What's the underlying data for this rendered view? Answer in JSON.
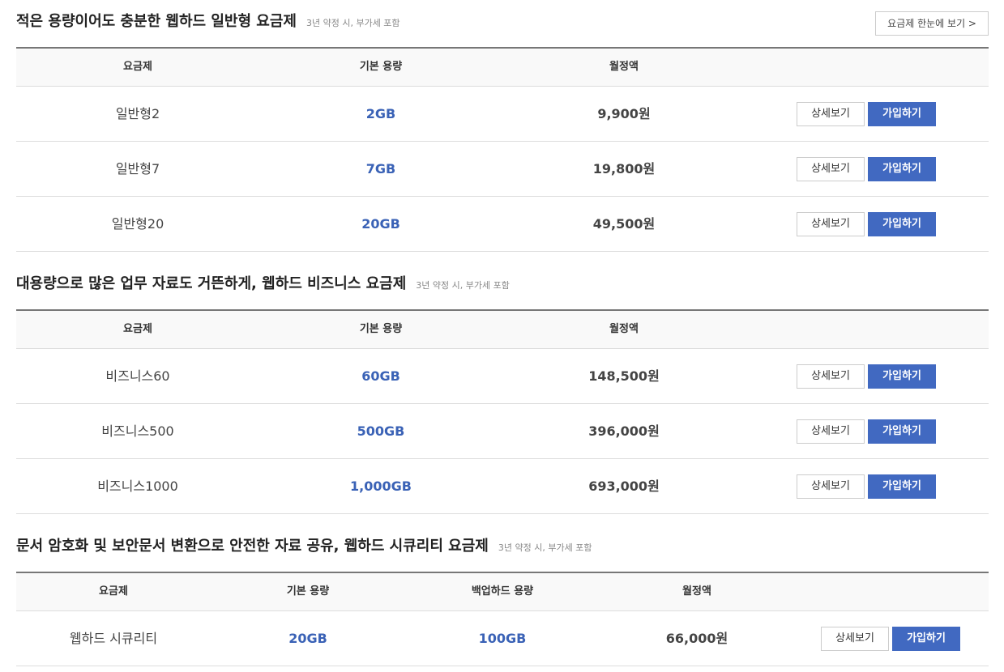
{
  "header_button": "요금제 한눈에 보기 >",
  "sections": [
    {
      "title": "적은 용량이어도 충분한 웹하드 일반형 요금제",
      "note": "3년 약정 시, 부가세 포함",
      "columns": [
        "요금제",
        "기본 용량",
        "월정액"
      ],
      "rows": [
        {
          "name": "일반형2",
          "capacity": "2GB",
          "price": "9,900원",
          "detail": "상세보기",
          "join": "가입하기"
        },
        {
          "name": "일반형7",
          "capacity": "7GB",
          "price": "19,800원",
          "detail": "상세보기",
          "join": "가입하기"
        },
        {
          "name": "일반형20",
          "capacity": "20GB",
          "price": "49,500원",
          "detail": "상세보기",
          "join": "가입하기"
        }
      ]
    },
    {
      "title": "대용량으로 많은 업무 자료도 거뜬하게, 웹하드 비즈니스 요금제",
      "note": "3년 약정 시, 부가세 포함",
      "columns": [
        "요금제",
        "기본 용량",
        "월정액"
      ],
      "rows": [
        {
          "name": "비즈니스60",
          "capacity": "60GB",
          "price": "148,500원",
          "detail": "상세보기",
          "join": "가입하기"
        },
        {
          "name": "비즈니스500",
          "capacity": "500GB",
          "price": "396,000원",
          "detail": "상세보기",
          "join": "가입하기"
        },
        {
          "name": "비즈니스1000",
          "capacity": "1,000GB",
          "price": "693,000원",
          "detail": "상세보기",
          "join": "가입하기"
        }
      ]
    },
    {
      "title": "문서 암호화 및 보안문서 변환으로 안전한 자료 공유, 웹하드 시큐리티 요금제",
      "note": "3년 약정 시, 부가세 포함",
      "columns": [
        "요금제",
        "기본 용량",
        "백업하드 용량",
        "월정액"
      ],
      "rows": [
        {
          "name": "웹하드 시큐리티",
          "capacity": "20GB",
          "backup": "100GB",
          "price": "66,000원",
          "detail": "상세보기",
          "join": "가입하기"
        }
      ]
    }
  ]
}
